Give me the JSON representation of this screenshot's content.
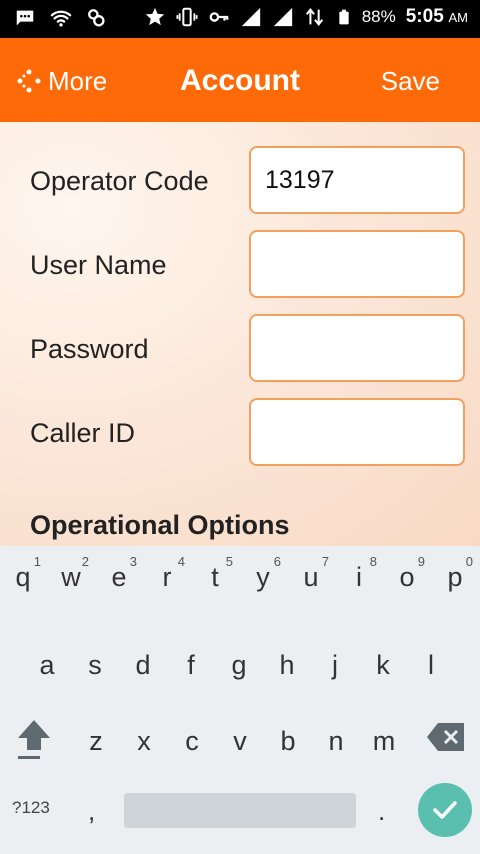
{
  "status_bar": {
    "battery": "88%",
    "time": "5:05",
    "ampm": "AM"
  },
  "header": {
    "more_label": "More",
    "title": "Account",
    "save_label": "Save"
  },
  "form": {
    "operator_code": {
      "label": "Operator Code",
      "value": "13197"
    },
    "user_name": {
      "label": "User Name",
      "value": ""
    },
    "password": {
      "label": "Password",
      "value": ""
    },
    "caller_id": {
      "label": "Caller ID",
      "value": ""
    },
    "section_title": "Operational Options"
  },
  "keyboard": {
    "row1": [
      {
        "char": "q",
        "hint": "1"
      },
      {
        "char": "w",
        "hint": "2"
      },
      {
        "char": "e",
        "hint": "3"
      },
      {
        "char": "r",
        "hint": "4"
      },
      {
        "char": "t",
        "hint": "5"
      },
      {
        "char": "y",
        "hint": "6"
      },
      {
        "char": "u",
        "hint": "7"
      },
      {
        "char": "i",
        "hint": "8"
      },
      {
        "char": "o",
        "hint": "9"
      },
      {
        "char": "p",
        "hint": "0"
      }
    ],
    "row2": [
      "a",
      "s",
      "d",
      "f",
      "g",
      "h",
      "j",
      "k",
      "l"
    ],
    "row3": [
      "z",
      "x",
      "c",
      "v",
      "b",
      "n",
      "m"
    ],
    "symbols_label": "?123",
    "comma": ",",
    "period": "."
  },
  "colors": {
    "header_bg": "#ff6a08",
    "field_border": "#f2a05e",
    "enter_key": "#5bbfb0"
  }
}
